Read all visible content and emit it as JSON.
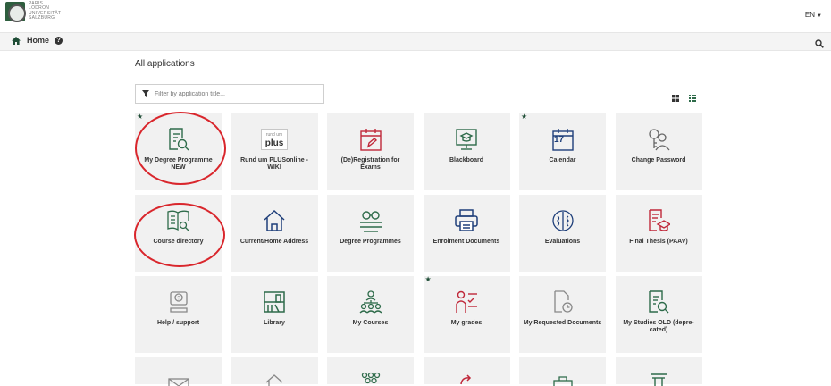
{
  "header": {
    "logo_lines": [
      "PARIS",
      "LODRON",
      "UNIVERSITÄT",
      "SALZBURG"
    ],
    "language": "EN"
  },
  "navbar": {
    "home_label": "Home",
    "help_icon": "question-circle-icon",
    "search_icon": "search-icon"
  },
  "main": {
    "title": "All applications",
    "filter_placeholder": "Filter by application title...",
    "view_toggle": [
      "grid-view-icon",
      "list-view-icon"
    ]
  },
  "tiles": [
    {
      "label": "My Degree Programme NEW",
      "icon": "document-search-icon",
      "favorite": true,
      "circled": true
    },
    {
      "label": "Rund um PLUSonline - WIKI",
      "icon": "rund-um-plus-logo",
      "favorite": false
    },
    {
      "label": "(De)Registration for Exams",
      "icon": "calendar-edit-icon",
      "favorite": false
    },
    {
      "label": "Blackboard",
      "icon": "blackboard-icon",
      "favorite": false
    },
    {
      "label": "Calendar",
      "icon": "calendar-icon",
      "favorite": true,
      "day": "17"
    },
    {
      "label": "Change Password",
      "icon": "key-user-icon",
      "favorite": false
    },
    {
      "label": "Course directory",
      "icon": "book-search-icon",
      "favorite": false,
      "circled": true
    },
    {
      "label": "Current/Home Address",
      "icon": "home-icon",
      "favorite": false
    },
    {
      "label": "Degree Programmes",
      "icon": "graduation-glasses-icon",
      "favorite": false
    },
    {
      "label": "Enrolment Documents",
      "icon": "printer-icon",
      "favorite": false
    },
    {
      "label": "Evaluations",
      "icon": "brain-icon",
      "favorite": false
    },
    {
      "label": "Final Thesis (PAAV)",
      "icon": "thesis-icon",
      "favorite": false
    },
    {
      "label": "Help / support",
      "icon": "help-support-icon",
      "favorite": false
    },
    {
      "label": "Library",
      "icon": "library-icon",
      "favorite": false
    },
    {
      "label": "My Courses",
      "icon": "group-icon",
      "favorite": false
    },
    {
      "label": "My grades",
      "icon": "grades-icon",
      "favorite": true
    },
    {
      "label": "My Requested Documents",
      "icon": "document-clock-icon",
      "favorite": false
    },
    {
      "label": "My Studies OLD (depre-cated)",
      "icon": "document-search-icon",
      "favorite": false
    },
    {
      "label": "",
      "icon": "mail-icon",
      "favorite": false,
      "partial": true
    },
    {
      "label": "",
      "icon": "house-outline-icon",
      "favorite": false,
      "partial": true
    },
    {
      "label": "",
      "icon": "people-icon",
      "favorite": false,
      "partial": true
    },
    {
      "label": "",
      "icon": "refresh-icon",
      "favorite": false,
      "partial": true
    },
    {
      "label": "",
      "icon": "briefcase-icon",
      "favorite": false,
      "partial": true
    },
    {
      "label": "",
      "icon": "pillar-icon",
      "favorite": false,
      "partial": true
    }
  ],
  "colors": {
    "brand_green": "#1f4d36",
    "icon_green": "#2e6b4a",
    "icon_blue": "#1f3f7a",
    "icon_red": "#c0283a",
    "annotation_red": "#d9262c",
    "tile_bg": "#f1f1f1"
  }
}
